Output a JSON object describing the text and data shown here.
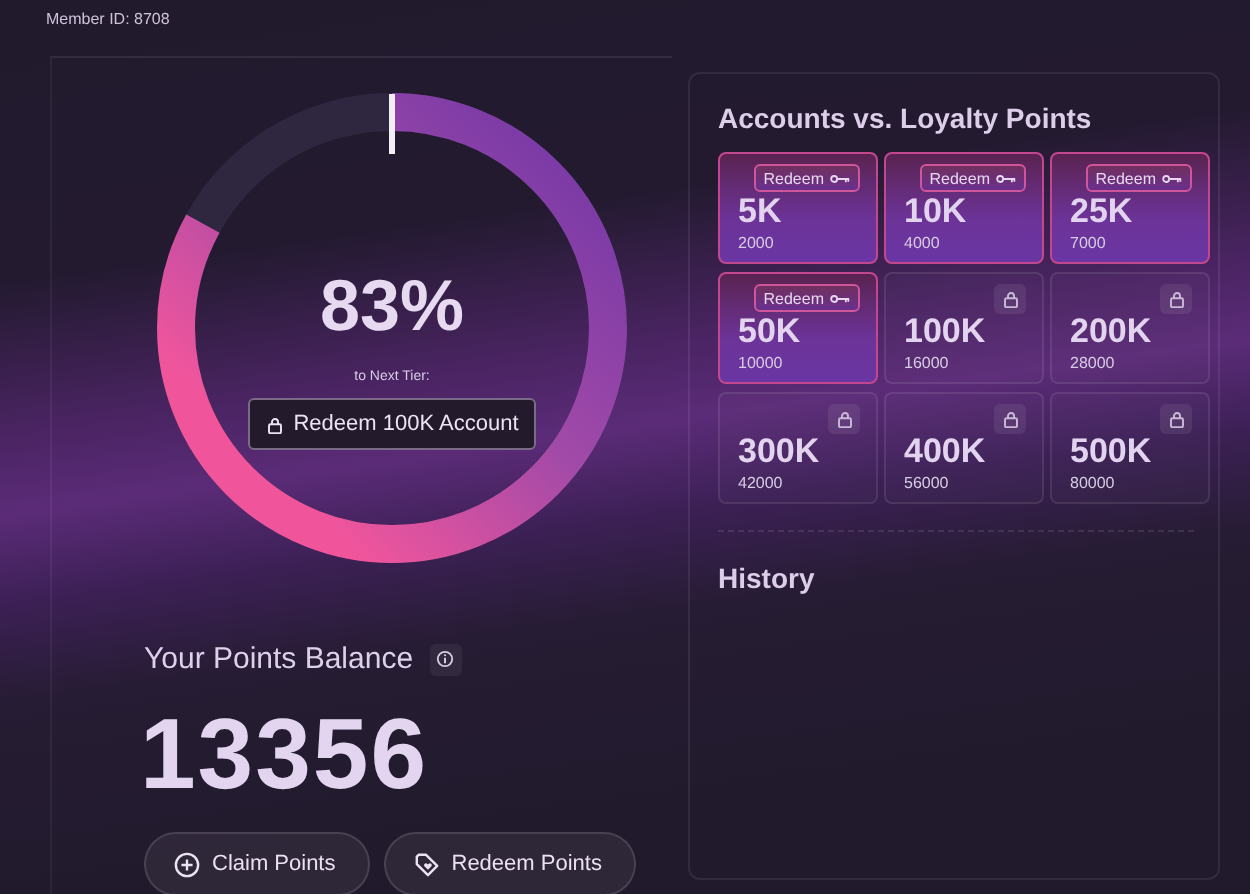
{
  "member_id": "Member ID: 8708",
  "progress": {
    "level": 0.83,
    "percent": "83%",
    "caption": "to Next Tier:",
    "button": "Redeem 100K Account"
  },
  "balance": {
    "title": "Your Points Balance",
    "value": "13356"
  },
  "actions": [
    {
      "kind": "claim",
      "label": "Claim Points"
    },
    {
      "kind": "redeem",
      "label": "Redeem Points"
    }
  ],
  "accounts": {
    "title": "Accounts vs. Loyalty Points",
    "tiers": [
      {
        "label": "5K",
        "points": "2000",
        "unlocked": true,
        "action": "Redeem"
      },
      {
        "label": "10K",
        "points": "4000",
        "unlocked": true,
        "action": "Redeem"
      },
      {
        "label": "25K",
        "points": "7000",
        "unlocked": true,
        "action": "Redeem"
      },
      {
        "label": "50K",
        "points": "10000",
        "unlocked": true,
        "action": "Redeem"
      },
      {
        "label": "100K",
        "points": "16000",
        "unlocked": false
      },
      {
        "label": "200K",
        "points": "28000",
        "unlocked": false
      },
      {
        "label": "300K",
        "points": "42000",
        "unlocked": false
      },
      {
        "label": "400K",
        "points": "56000",
        "unlocked": false
      },
      {
        "label": "500K",
        "points": "80000",
        "unlocked": false
      }
    ]
  },
  "history": {
    "title": "History"
  }
}
